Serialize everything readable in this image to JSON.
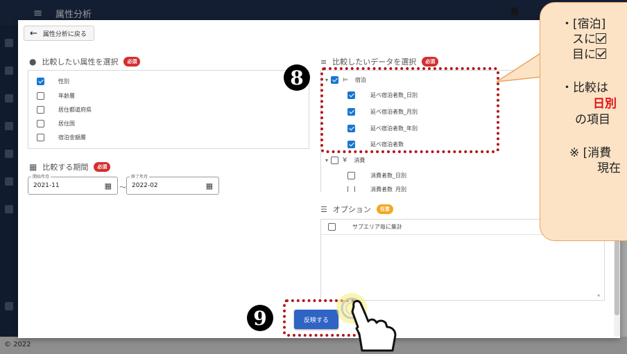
{
  "appbar": {
    "title": "属性分析",
    "menu_icon": "menu-icon",
    "bell_icon": "bell-icon"
  },
  "footer": {
    "copyright": "© 2022"
  },
  "dialog": {
    "back_label": "属性分析に戻る",
    "attributes": {
      "title": "比較したい属性を選択",
      "badge": "必須",
      "items": [
        {
          "label": "性別",
          "checked": true
        },
        {
          "label": "年齢層",
          "checked": false
        },
        {
          "label": "居住都道府県",
          "checked": false
        },
        {
          "label": "居住国",
          "checked": false
        },
        {
          "label": "宿泊金額層",
          "checked": false
        }
      ]
    },
    "period": {
      "title": "比較する期間",
      "badge": "必須",
      "start_label": "開始年月",
      "start_value": "2021-11",
      "separator": "〜",
      "end_label": "終了年月",
      "end_value": "2022-02"
    },
    "data_select": {
      "title": "比較したいデータを選択",
      "badge": "必須",
      "group_stay": "宿泊",
      "stay_items": [
        {
          "label": "延べ宿泊者数_日別",
          "checked": true
        },
        {
          "label": "延べ宿泊者数_月別",
          "checked": true
        },
        {
          "label": "延べ宿泊者数_年別",
          "checked": true
        },
        {
          "label": "延べ宿泊者数",
          "checked": true
        }
      ],
      "group_consumption": "消費",
      "consumption_items": [
        {
          "label": "消費者数_日別",
          "checked": false
        },
        {
          "label": "消費者数_月別",
          "checked": false
        }
      ]
    },
    "options": {
      "title": "オプション",
      "badge": "任意",
      "items": [
        {
          "label": "サブエリア毎に集計",
          "checked": false
        }
      ]
    },
    "apply_label": "反映する"
  },
  "markers": {
    "m8": "8",
    "m9": "9"
  },
  "callout": {
    "line1": "・[宿泊]",
    "line2": "スに",
    "line3": "目に",
    "line4": "・比較は",
    "line5": "日別",
    "line6": "の項目",
    "line7": "※ [消費",
    "line8": "現在"
  },
  "colors": {
    "accent": "#1976d2",
    "required": "#d32f2f",
    "optional": "#f5a623",
    "apply": "#2f63c4",
    "highlight": "#b3151c"
  }
}
